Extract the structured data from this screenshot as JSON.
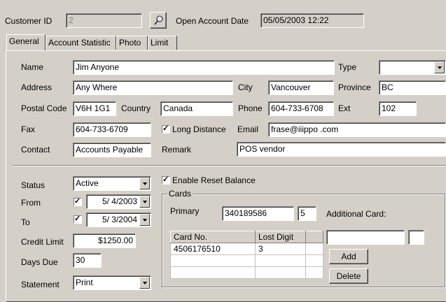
{
  "header": {
    "customer_id_label": "Customer ID",
    "customer_id_value": "2",
    "open_date_label": "Open Account Date",
    "open_date_value": "05/05/2003 12:22"
  },
  "tabs": [
    {
      "label": "General",
      "active": true
    },
    {
      "label": "Account Statistic",
      "active": false
    },
    {
      "label": "Photo",
      "active": false
    },
    {
      "label": "Limit",
      "active": false
    }
  ],
  "general": {
    "name_label": "Name",
    "name": "Jim Anyone",
    "type_label": "Type",
    "type": "",
    "address_label": "Address",
    "address": "Any Where",
    "city_label": "City",
    "city": "Vancouver",
    "province_label": "Province",
    "province": "BC",
    "postal_label": "Postal Code",
    "postal": "V6H 1G1",
    "country_label": "Country",
    "country": "Canada",
    "phone_label": "Phone",
    "phone": "604-733-6708",
    "ext_label": "Ext",
    "ext": "102",
    "fax_label": "Fax",
    "fax": "604-733-6709",
    "long_distance_label": "Long Distance",
    "email_label": "Email",
    "email": "frase@iiippo .com",
    "contact_label": "Contact",
    "contact": "Accounts Payable",
    "remark_label": "Remark",
    "remark": "POS vendor"
  },
  "account": {
    "status_label": "Status",
    "status": "Active",
    "from_label": "From",
    "from": "5/ 4/2003",
    "to_label": "To",
    "to": "5/ 3/2004",
    "credit_limit_label": "Credit Limit",
    "credit_limit": "$1250.00",
    "days_due_label": "Days Due",
    "days_due": "30",
    "statement_label": "Statement",
    "statement": "Print",
    "enable_reset_label": "Enable Reset Balance"
  },
  "cards": {
    "group_label": "Cards",
    "primary_label": "Primary",
    "primary": "340189586",
    "primary_digit": "5",
    "additional_label": "Additional Card:",
    "columns": [
      "Card No.",
      "Lost Digit",
      ""
    ],
    "rows": [
      [
        "4506176510",
        "3",
        ""
      ],
      [
        "",
        "",
        ""
      ],
      [
        "",
        "",
        ""
      ]
    ],
    "add_label": "Add",
    "delete_label": "Delete"
  }
}
